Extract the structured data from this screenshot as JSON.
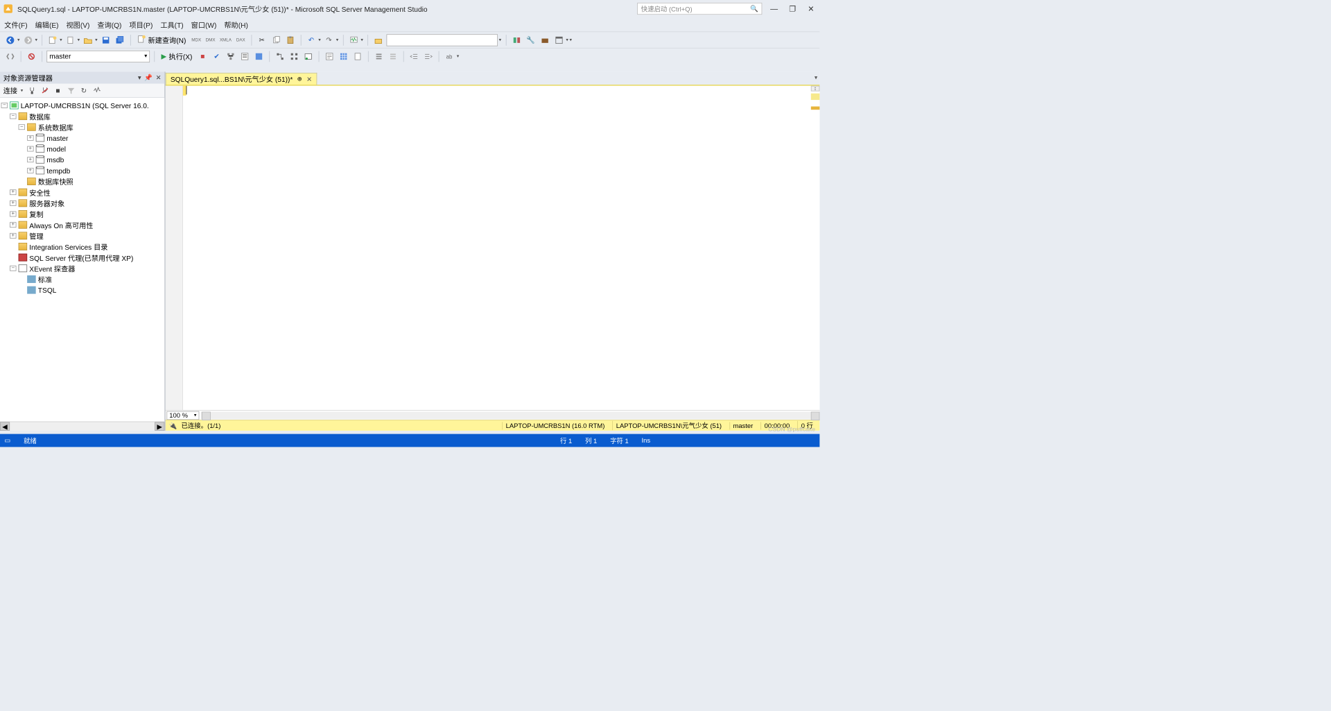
{
  "window": {
    "title": "SQLQuery1.sql - LAPTOP-UMCRBS1N.master (LAPTOP-UMCRBS1N\\元气少女 (51))* - Microsoft SQL Server Management Studio",
    "quick_launch_placeholder": "快速启动 (Ctrl+Q)"
  },
  "menu": {
    "file": "文件(F)",
    "edit": "编辑(E)",
    "view": "视图(V)",
    "query": "查询(Q)",
    "project": "项目(P)",
    "tools": "工具(T)",
    "window": "窗口(W)",
    "help": "帮助(H)"
  },
  "toolbar1": {
    "new_query": "新建查询(N)",
    "db_selected": "master",
    "execute": "执行(X)"
  },
  "object_explorer": {
    "title": "对象资源管理器",
    "connect_label": "连接",
    "tree": {
      "server": "LAPTOP-UMCRBS1N (SQL Server 16.0.",
      "databases": "数据库",
      "system_databases": "系统数据库",
      "dbs": [
        "master",
        "model",
        "msdb",
        "tempdb"
      ],
      "db_snapshots": "数据库快照",
      "security": "安全性",
      "server_objects": "服务器对象",
      "replication": "复制",
      "always_on": "Always On 高可用性",
      "management": "管理",
      "integration": "Integration Services 目录",
      "agent": "SQL Server 代理(已禁用代理 XP)",
      "xevent": "XEvent 探查器",
      "xevent_children": [
        "标准",
        "TSQL"
      ]
    }
  },
  "editor": {
    "tab_label": "SQLQuery1.sql...BS1N\\元气少女 (51))*",
    "zoom": "100 %"
  },
  "conn": {
    "status": "已连接。(1/1)",
    "server": "LAPTOP-UMCRBS1N (16.0 RTM)",
    "user": "LAPTOP-UMCRBS1N\\元气少女 (51)",
    "db": "master",
    "elapsed": "00:00:00",
    "rows": "0 行"
  },
  "status": {
    "ready": "就绪",
    "line": "行 1",
    "col": "列 1",
    "char": "字符 1",
    "ins": "Ins"
  },
  "watermark": "CSDN @puffcake"
}
